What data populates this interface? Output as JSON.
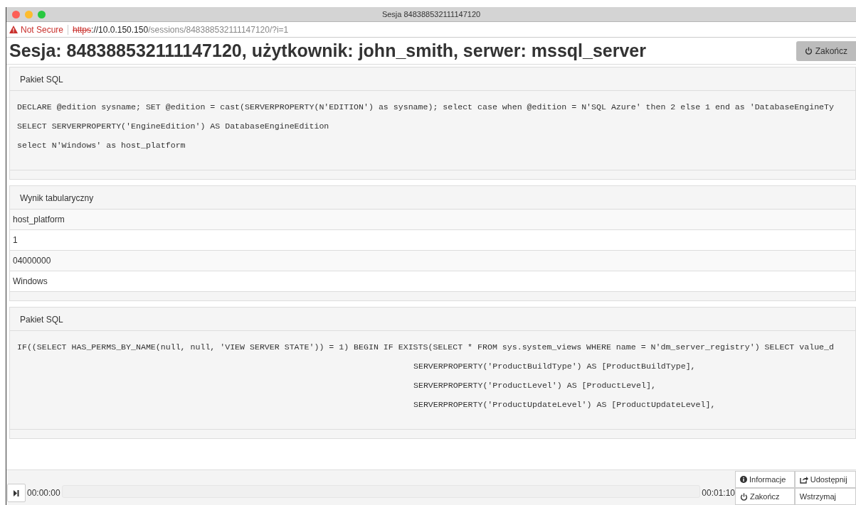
{
  "window": {
    "title": "Sesja 848388532111147120"
  },
  "address_bar": {
    "warning": "Not Secure",
    "scheme": "https",
    "host": "://10.0.150.150",
    "path": "/sessions/848388532111147120/?i=1"
  },
  "heading": "Sesja: 848388532111147120, użytkownik: john_smith, serwer: mssql_server",
  "end_button": "Zakończ",
  "panels": [
    {
      "kind": "sql",
      "title": "Pakiet SQL",
      "lines": [
        {
          "text": "DECLARE @edition sysname; SET @edition = cast(SERVERPROPERTY(N'EDITION') as sysname); select case when @edition = N'SQL Azure' then 2 else 1 end as 'DatabaseEngineTy",
          "indented": false
        },
        {
          "text": "SELECT SERVERPROPERTY('EngineEdition') AS DatabaseEngineEdition",
          "indented": false
        },
        {
          "text": "select N'Windows' as host_platform",
          "indented": false
        }
      ]
    },
    {
      "kind": "table",
      "title": "Wynik tabularyczny",
      "rows": [
        "host_platform",
        "1",
        "04000000",
        "Windows"
      ]
    },
    {
      "kind": "sql",
      "title": "Pakiet SQL",
      "lines": [
        {
          "text": "IF((SELECT HAS_PERMS_BY_NAME(null, null, 'VIEW SERVER STATE')) = 1) BEGIN IF EXISTS(SELECT * FROM sys.system_views WHERE name = N'dm_server_registry') SELECT value_d",
          "indented": false
        },
        {
          "text": "SERVERPROPERTY('ProductBuildType') AS [ProductBuildType],",
          "indented": true
        },
        {
          "text": "SERVERPROPERTY('ProductLevel') AS [ProductLevel],",
          "indented": true
        },
        {
          "text": "SERVERPROPERTY('ProductUpdateLevel') AS [ProductUpdateLevel],",
          "indented": true
        }
      ]
    }
  ],
  "player": {
    "start_time": "00:00:00",
    "end_time": "00:01:10",
    "buttons": [
      {
        "label": "Informacje"
      },
      {
        "label": "Udostępnij"
      },
      {
        "label": "Zakończ"
      },
      {
        "label": "Wstrzymaj"
      }
    ]
  }
}
